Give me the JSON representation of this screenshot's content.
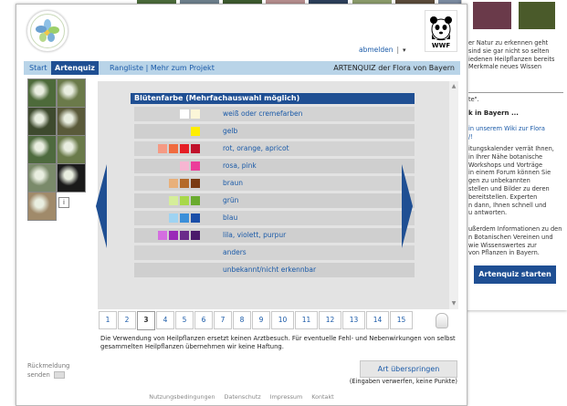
{
  "background_page": {
    "top_strip_colors": [
      "#4a6b3a",
      "#6c7f8b",
      "#3d5a2e",
      "#b48c8c",
      "#2c3f5a",
      "#8a9a6a",
      "#5a4a3a",
      "#7a8aa0",
      "#3a5a3a",
      "#9a7a6a"
    ],
    "panel_lines": [
      "er Natur zu erkennen geht",
      "sind sie gar nicht so selten",
      "iedenen Heilpflanzen bereits",
      "Merkmale neues Wissen"
    ],
    "panel_quote": "te\".",
    "panel_heading": "k in Bayern ...",
    "panel_wiki": "in unserem Wiki zur Flora",
    "panel_wiki_tail": "/!",
    "panel_lines2": [
      "itungskalender verrät Ihnen,",
      "in Ihrer Nähe botanische",
      "Workshops und Vorträge",
      "in einem Forum können Sie",
      "gen zu unbekannten",
      "stellen und Bilder zu deren",
      "bereitstellen. Experten",
      "n dann, Ihnen schnell und",
      "u antworten."
    ],
    "panel_lines3": [
      "ußerdem Informationen zu den",
      "n Botanischen Vereinen und",
      "wie Wissenswertes zur",
      "von Pflanzen in Bayern."
    ],
    "start_button": "Artenquiz starten"
  },
  "header": {
    "logo_text": "FLORA VON BAYERN",
    "wwf_text": "WWF",
    "logout": "abmelden",
    "separator": "|",
    "dropdown_arrow": "▾"
  },
  "nav": {
    "items": [
      {
        "label": "Start"
      },
      {
        "label": "Artenquiz"
      },
      {
        "label": "Rangliste | Mehr zum Projekt"
      }
    ],
    "title": "ARTENQUIZ der Flora von Bayern"
  },
  "thumbnails": {
    "colors": [
      "#4d6a3a",
      "#6b7a4a",
      "#3e4a2e",
      "#5a5a3a",
      "#4e6a3e",
      "#6a7a4a",
      "#7a8a6a",
      "#1a1a1a",
      "#a08a6a"
    ],
    "info": "i"
  },
  "quiz": {
    "header": "Blütenfarbe (Mehrfachauswahl möglich)",
    "options": [
      {
        "label": "weiß oder cremefarben",
        "swatches": [
          "#ffffff",
          "#fbf6d8"
        ]
      },
      {
        "label": "gelb",
        "swatches": [
          "#ffee00"
        ]
      },
      {
        "label": "rot, orange, apricot",
        "swatches": [
          "#f59a84",
          "#f06b3f",
          "#e51e25",
          "#c0102a"
        ]
      },
      {
        "label": "rosa, pink",
        "swatches": [
          "#f7b6d2",
          "#ec3d9a"
        ]
      },
      {
        "label": "braun",
        "swatches": [
          "#e8b07a",
          "#b46a2a",
          "#7a3a12"
        ]
      },
      {
        "label": "grün",
        "swatches": [
          "#d5ee9a",
          "#a8d84a",
          "#6aab2e"
        ]
      },
      {
        "label": "blau",
        "swatches": [
          "#9ed3f2",
          "#3b8fd9",
          "#1a4ea8"
        ]
      },
      {
        "label": "lila, violett, purpur",
        "swatches": [
          "#d46ee0",
          "#9a2ab8",
          "#6a2a8a",
          "#4a1a6a"
        ]
      },
      {
        "label": "anders",
        "swatches": []
      },
      {
        "label": "unbekannt/nicht erkennbar",
        "swatches": []
      }
    ]
  },
  "pagination": {
    "pages": [
      "1",
      "2",
      "3",
      "4",
      "5",
      "6",
      "7",
      "8",
      "9",
      "10",
      "11",
      "12",
      "13",
      "14",
      "15"
    ],
    "current": "3"
  },
  "disclaimer": "Die Verwendung von Heilpflanzen ersetzt keinen Arztbesuch. Für eventuelle Fehl- und Nebenwirkungen von selbst gesammelten Heilpflanzen übernehmen wir keine Haftung.",
  "feedback": {
    "line1": "Rückmeldung",
    "line2": "senden"
  },
  "skip": {
    "button": "Art überspringen",
    "note": "(Eingaben verwerfen, keine Punkte)"
  },
  "footer": [
    "Nutzungsbedingungen",
    "Datenschutz",
    "Impressum",
    "Kontakt"
  ],
  "colors": {
    "primary": "#1f4f93",
    "nav_bg": "#b9d4e8",
    "link": "#1a5aa8"
  }
}
